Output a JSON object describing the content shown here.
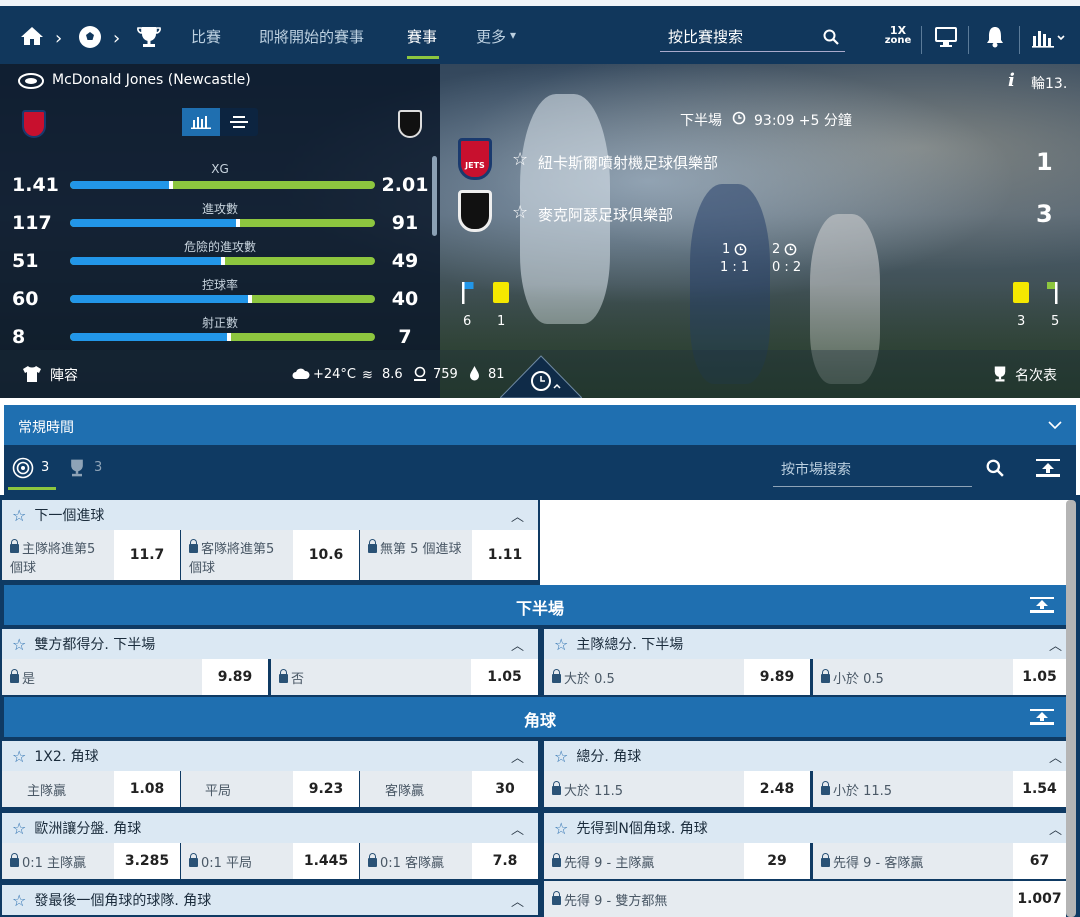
{
  "nav": {
    "items": [
      "比賽",
      "即將開始的賽事",
      "賽事",
      "更多"
    ],
    "search_placeholder": "按比賽搜索",
    "onex_zone": "1X",
    "onex_zone2": "zone"
  },
  "match": {
    "venue": "McDonald Jones (Newcastle)",
    "round": "輪13.",
    "period": "下半場",
    "clock": "93:09 +5 分鐘",
    "home": {
      "name": "紐卡斯爾噴射機足球俱樂部",
      "score": "1",
      "badge": "JETS"
    },
    "away": {
      "name": "麥克阿瑟足球俱樂部",
      "score": "3"
    },
    "half1": {
      "label": "1",
      "score": "1 : 1"
    },
    "half2": {
      "label": "2",
      "score": "0 : 2"
    },
    "home_corners": "6",
    "home_yellow": "1",
    "away_yellow": "3",
    "away_corners": "5",
    "lineup": "陣容",
    "weather": "+24°C",
    "wind": "8.6",
    "pressure": "759",
    "humidity": "81",
    "standings": "名次表"
  },
  "stats": [
    {
      "label": "XG",
      "home": "1.41",
      "away": "2.01",
      "share": 0.33
    },
    {
      "label": "進攻數",
      "home": "117",
      "away": "91",
      "share": 0.55
    },
    {
      "label": "危險的進攻數",
      "home": "51",
      "away": "49",
      "share": 0.5
    },
    {
      "label": "控球率",
      "home": "60",
      "away": "40",
      "share": 0.59
    },
    {
      "label": "射正數",
      "home": "8",
      "away": "7",
      "share": 0.52
    }
  ],
  "regular_time": "常規時間",
  "tabs": {
    "markets_count": "3",
    "trophy_count": "3",
    "market_search": "按市場搜索"
  },
  "markets": {
    "next_goal": {
      "title": "下一個進球",
      "opts": [
        {
          "label": "主隊將進第5 個球",
          "odd": "11.7"
        },
        {
          "label": "客隊將進第5 個球",
          "odd": "10.6"
        },
        {
          "label": "無第 5 個進球",
          "odd": "1.11"
        }
      ]
    },
    "section_2h": "下半場",
    "btts": {
      "title": "雙方都得分. 下半場",
      "yes": "是",
      "yes_odd": "9.89",
      "no": "否",
      "no_odd": "1.05"
    },
    "home_total": {
      "title": "主隊總分. 下半場",
      "over": "大於 0.5",
      "over_odd": "9.89",
      "under": "小於 0.5",
      "under_odd": "1.05"
    },
    "section_corners": "角球",
    "corner_1x2": {
      "title": "1X2. 角球",
      "home": "主隊贏",
      "home_odd": "1.08",
      "draw": "平局",
      "draw_odd": "9.23",
      "away": "客隊贏",
      "away_odd": "30"
    },
    "corner_total": {
      "title": "總分. 角球",
      "over": "大於 11.5",
      "over_odd": "2.48",
      "under": "小於 11.5",
      "under_odd": "1.54"
    },
    "corner_euro": {
      "title": "歐洲讓分盤. 角球",
      "a": "0:1 主隊贏",
      "a_odd": "3.285",
      "b": "0:1 平局",
      "b_odd": "1.445",
      "c": "0:1 客隊贏",
      "c_odd": "7.8"
    },
    "corner_race": {
      "title": "先得到N個角球. 角球",
      "a": "先得 9 - 主隊贏",
      "a_odd": "29",
      "b": "先得 9 - 客隊贏",
      "b_odd": "67",
      "c": "先得 9 - 雙方都無",
      "c_odd": "1.007"
    },
    "last_corner": {
      "title": "發最後一個角球的球隊. 角球"
    }
  }
}
